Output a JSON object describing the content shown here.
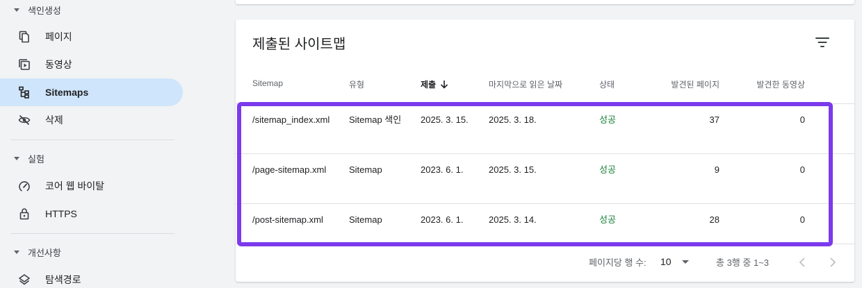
{
  "sidebar": {
    "section1": "색인생성",
    "items1": [
      {
        "label": "페이지",
        "icon": "pages-icon"
      },
      {
        "label": "동영상",
        "icon": "video-icon"
      },
      {
        "label": "Sitemaps",
        "icon": "sitemap-icon",
        "active": true
      },
      {
        "label": "삭제",
        "icon": "visibility-off-icon"
      }
    ],
    "section2": "실험",
    "items2": [
      {
        "label": "코어 웹 바이탈",
        "icon": "speed-gauge-icon"
      },
      {
        "label": "HTTPS",
        "icon": "lock-icon"
      }
    ],
    "section3": "개선사항",
    "items3": [
      {
        "label": "탐색경로",
        "icon": "layers-icon"
      }
    ]
  },
  "card": {
    "title": "제출된 사이트맵",
    "columns": {
      "sitemap": "Sitemap",
      "type": "유형",
      "submitted": "제출",
      "last_read": "마지막으로 읽은 날짜",
      "status": "상태",
      "discovered_pages": "발견된 페이지",
      "discovered_videos": "발견한 동영상"
    },
    "rows": [
      {
        "path": "/sitemap_index.xml",
        "type": "Sitemap 색인",
        "submitted": "2025. 3. 15.",
        "last_read": "2025. 3. 18.",
        "status": "성공",
        "pages": "37",
        "videos": "0"
      },
      {
        "path": "/page-sitemap.xml",
        "type": "Sitemap",
        "submitted": "2023. 6. 1.",
        "last_read": "2025. 3. 15.",
        "status": "성공",
        "pages": "9",
        "videos": "0"
      },
      {
        "path": "/post-sitemap.xml",
        "type": "Sitemap",
        "submitted": "2023. 6. 1.",
        "last_read": "2025. 3. 14.",
        "status": "성공",
        "pages": "28",
        "videos": "0"
      }
    ],
    "pager": {
      "rows_per_page_label": "페이지당 행 수:",
      "rows_per_page": "10",
      "range": "총 3행 중 1~3"
    }
  },
  "colors": {
    "accent_highlight": "#7c3aed",
    "active_nav": "#cfe5fb",
    "success": "#188038"
  }
}
